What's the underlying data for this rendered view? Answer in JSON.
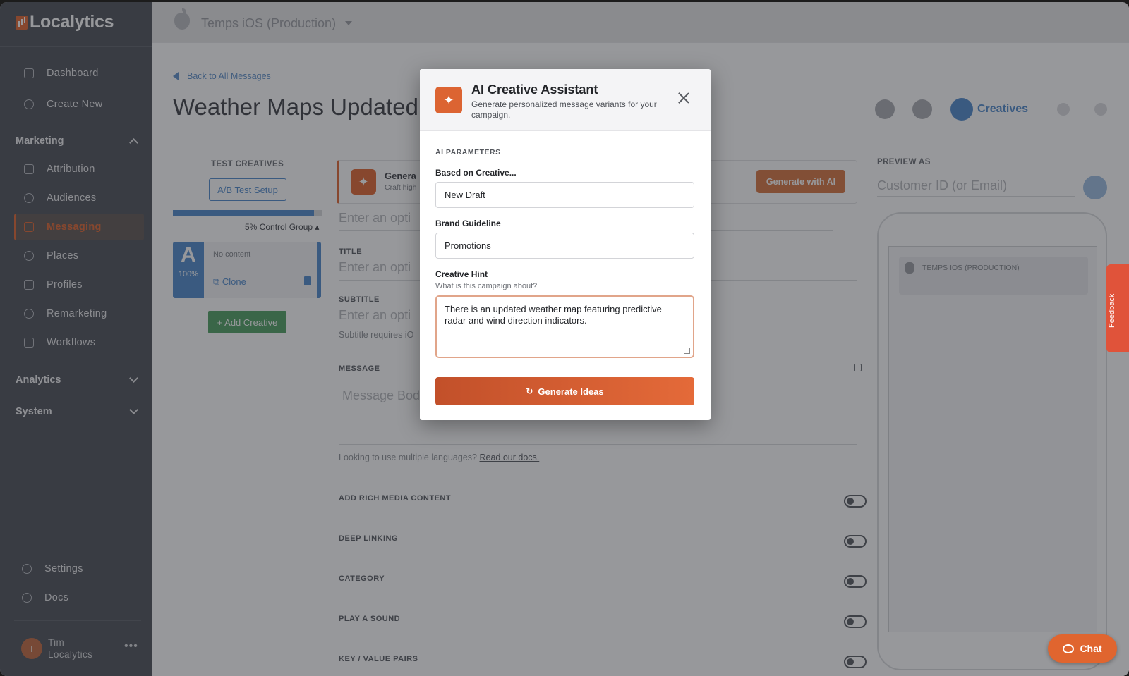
{
  "app": {
    "brand": "Localytics",
    "app_selector": "Temps iOS (Production)"
  },
  "sidebar": {
    "top_items": [
      {
        "label": "Dashboard"
      },
      {
        "label": "Create New"
      }
    ],
    "marketing": {
      "label": "Marketing",
      "items": [
        {
          "label": "Attribution"
        },
        {
          "label": "Audiences"
        },
        {
          "label": "Messaging"
        },
        {
          "label": "Places"
        },
        {
          "label": "Profiles"
        },
        {
          "label": "Remarketing"
        },
        {
          "label": "Workflows"
        }
      ]
    },
    "analytics_label": "Analytics",
    "system_label": "System",
    "bottom_items": [
      {
        "label": "Settings"
      },
      {
        "label": "Docs"
      }
    ],
    "user": {
      "initial": "T",
      "first": "Tim",
      "last": "Localytics",
      "menu": "•••"
    }
  },
  "page": {
    "back_link": "Back to All Messages",
    "title": "Weather Maps Updated",
    "header_tab": "Creatives",
    "test_creatives": {
      "heading": "TEST CREATIVES",
      "ab_button": "A/B Test Setup",
      "progress_fraction": 0.95,
      "control_group": "5% Control Group",
      "creative": {
        "letter": "A",
        "percent": "100%",
        "content": "No content",
        "clone": "Clone"
      },
      "add_button": "+ Add Creative"
    },
    "generate_banner": {
      "title": "Genera",
      "subtitle": "Craft high",
      "button": "Generate with AI"
    },
    "fields": {
      "option_placeholder": "Enter an opti",
      "title_label": "TITLE",
      "subtitle_label": "SUBTITLE",
      "subtitle_note": "Subtitle requires iO",
      "message_label": "MESSAGE",
      "message_placeholder": "Message Bod",
      "languages_note": "Looking to use multiple languages?",
      "languages_link": "Read our docs."
    },
    "toggles": [
      {
        "label": "ADD RICH MEDIA CONTENT"
      },
      {
        "label": "DEEP LINKING"
      },
      {
        "label": "CATEGORY"
      },
      {
        "label": "PLAY A SOUND"
      },
      {
        "label": "KEY / VALUE PAIRS"
      }
    ],
    "preview": {
      "label": "PREVIEW AS",
      "placeholder": "Customer ID (or Email)",
      "notification_app": "TEMPS IOS (PRODUCTION)"
    }
  },
  "feedback_label": "Feedback",
  "chat_label": "Chat",
  "modal": {
    "title": "AI Creative Assistant",
    "subtitle": "Generate personalized message variants for your campaign.",
    "section": "AI PARAMETERS",
    "based_on": {
      "label": "Based on Creative...",
      "value": "New Draft"
    },
    "brand_guideline": {
      "label": "Brand Guideline",
      "value": "Promotions"
    },
    "creative_hint": {
      "label": "Creative Hint",
      "help": "What is this campaign about?",
      "value": "There is an updated weather map featuring predictive radar and wind direction indicators."
    },
    "generate_button": "Generate Ideas"
  },
  "colors": {
    "accent": "#e0652f",
    "link_blue": "#4e89cc",
    "sidebar": "#4b4f57"
  },
  "icons": [
    "grid-icon",
    "plus-circle-icon",
    "tag-icon",
    "user-icon",
    "chat-icon",
    "pin-icon",
    "id-card-icon",
    "target-icon",
    "workflow-icon",
    "gear-icon",
    "info-icon",
    "sparkle-icon",
    "close-icon",
    "refresh-icon",
    "apple-icon"
  ]
}
